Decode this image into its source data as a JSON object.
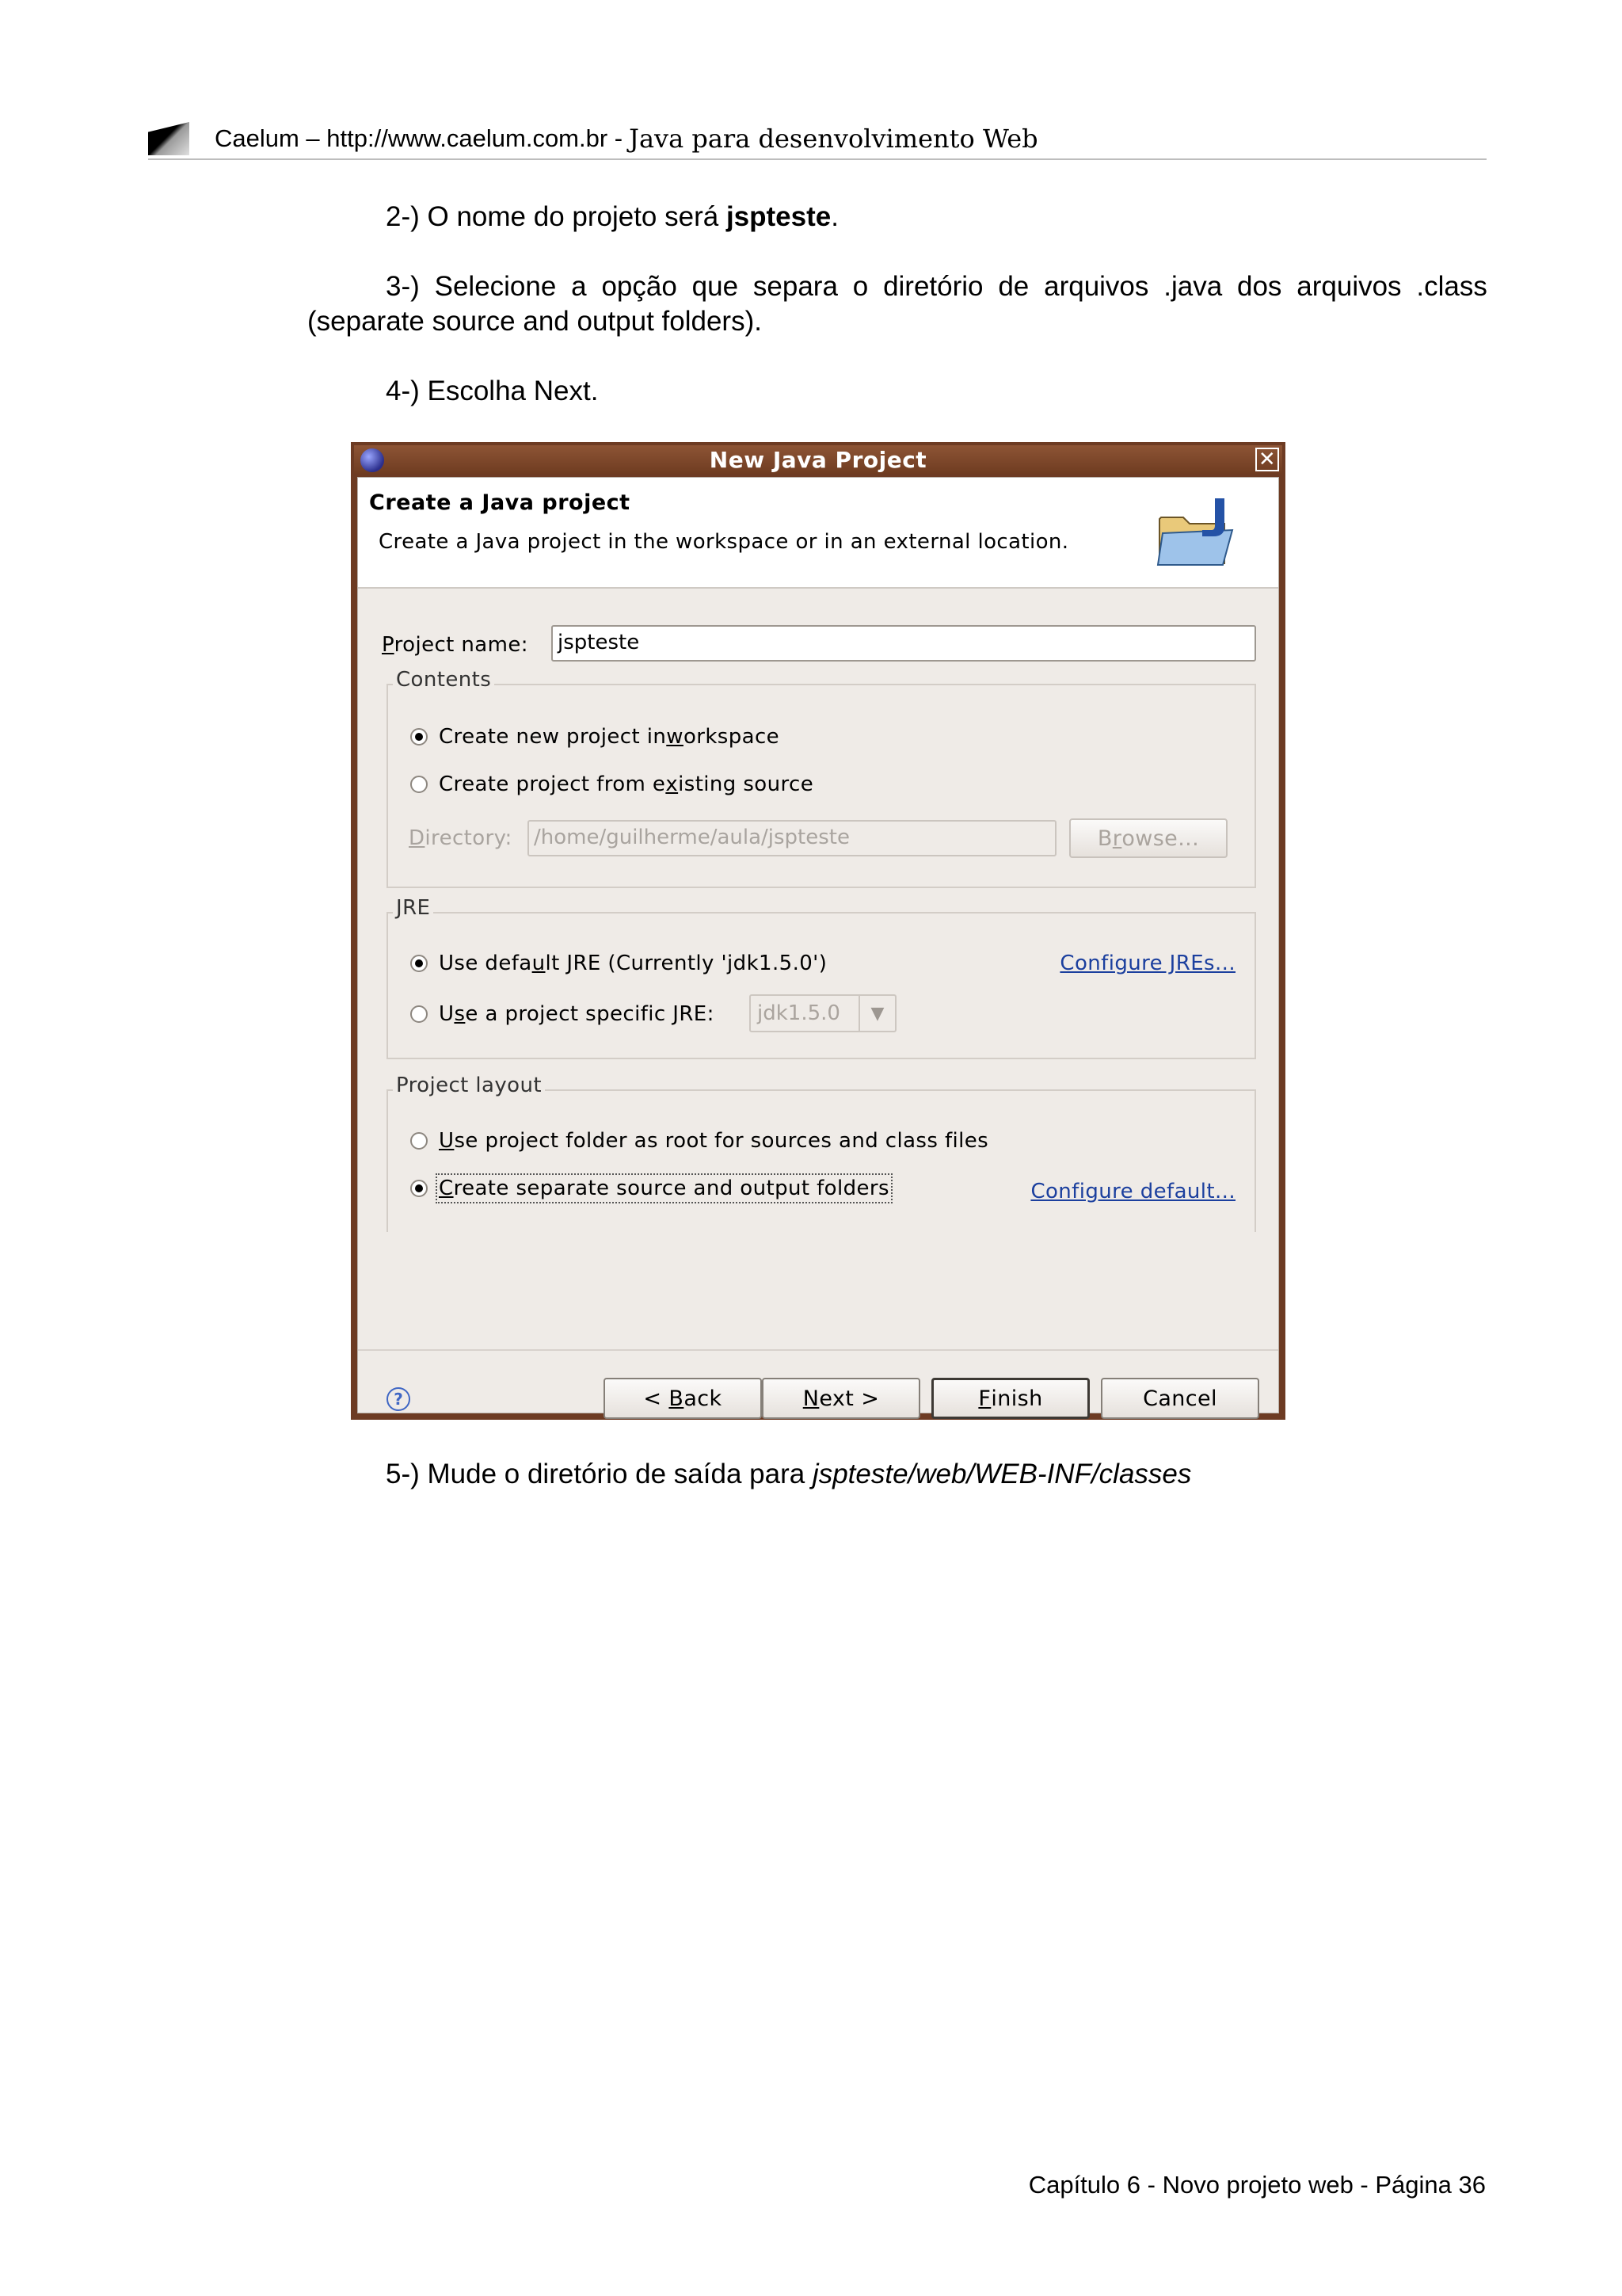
{
  "header": {
    "brand": "Caelum – http://www.caelum.com.br -",
    "subtitle": "Java para desenvolvimento Web"
  },
  "steps": {
    "step2_prefix": "2-) O nome do projeto será ",
    "step2_bold": "jspteste",
    "step2_suffix": ".",
    "step3_words": [
      "3-)",
      "Selecione",
      "a",
      "opção",
      "que",
      "separa",
      "o",
      "diretório",
      "de",
      "arquivos",
      ".java",
      "dos",
      "arquivos",
      ".class"
    ],
    "step3_line2": "(separate source and output folders).",
    "step4": "4-) Escolha Next.",
    "step5_prefix": "5-) Mude o diretório de saída para ",
    "step5_italic": "jspteste/web/WEB-INF/classes"
  },
  "dialog": {
    "title": "New Java Project",
    "close_glyph": "✕",
    "banner_title": "Create a Java project",
    "banner_desc": "Create a Java project in the workspace or in an external location.",
    "project_name_label_mn": "P",
    "project_name_label_rest": "roject name:",
    "project_name_value": "jspteste",
    "contents": {
      "title": "Contents",
      "opt_new_a": "Create new project in ",
      "opt_new_mn": "w",
      "opt_new_b": "orkspace",
      "opt_existing_a": "Create project from e",
      "opt_existing_mn": "x",
      "opt_existing_b": "isting source",
      "directory_mn": "D",
      "directory_rest": "irectory:",
      "directory_value": "/home/guilherme/aula/jspteste",
      "browse_a": "B",
      "browse_mn": "r",
      "browse_b": "owse..."
    },
    "jre": {
      "title": "JRE",
      "opt_default_a": "Use defa",
      "opt_default_mn": "u",
      "opt_default_b": "lt JRE (Currently 'jdk1.5.0')",
      "configure_jres": "Configure JREs...",
      "opt_specific_a": "U",
      "opt_specific_mn": "s",
      "opt_specific_b": "e a project specific JRE:",
      "specific_value": "jdk1.5.0",
      "arrow_glyph": "▼"
    },
    "layout": {
      "title": "Project layout",
      "opt_root_mn": "U",
      "opt_root_rest": "se project folder as root for sources and class files",
      "opt_separate_mn": "C",
      "opt_separate_rest": "reate separate source and output folders",
      "configure_default": "Configure default..."
    },
    "buttons": {
      "help_glyph": "?",
      "back_a": "< ",
      "back_mn": "B",
      "back_b": "ack",
      "next_mn": "N",
      "next_b": "ext >",
      "finish_mn": "F",
      "finish_b": "inish",
      "cancel": "Cancel"
    }
  },
  "footer": "Capítulo 6 - Novo projeto web - Página 36"
}
